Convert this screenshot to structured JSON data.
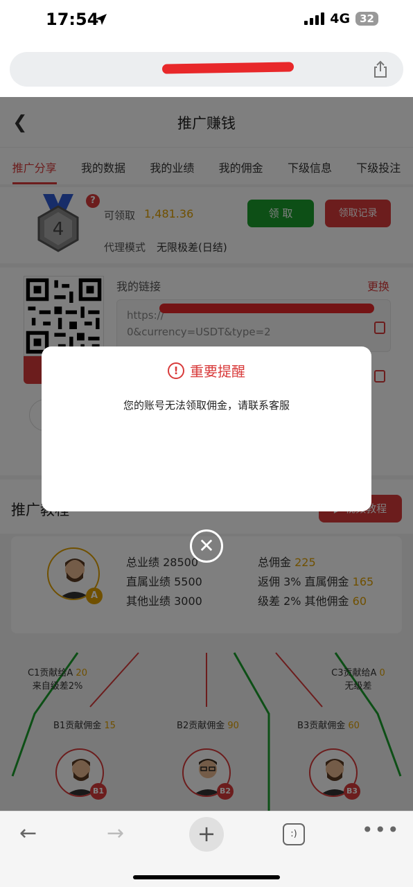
{
  "status_bar": {
    "time": "17:54",
    "network": "4G",
    "battery": "32"
  },
  "browser": {
    "toolbar_tabs_icon_text": ":)"
  },
  "header": {
    "back_icon": "chevron-left-icon",
    "title": "推广赚钱"
  },
  "tabs": [
    {
      "label": "推广分享",
      "active": true
    },
    {
      "label": "我的数据",
      "active": false
    },
    {
      "label": "我的业绩",
      "active": false
    },
    {
      "label": "我的佣金",
      "active": false
    },
    {
      "label": "下级信息",
      "active": false
    },
    {
      "label": "下级投注",
      "active": false
    }
  ],
  "reward": {
    "level": "4",
    "help_badge": "?",
    "claim_label": "可领取",
    "claim_amount": "1,481.36",
    "claim_button": "领 取",
    "record_button": "领取记录",
    "agent_mode_label": "代理模式",
    "agent_mode_value": "无限极差(日结)"
  },
  "link": {
    "label": "我的链接",
    "change_label": "更换",
    "url_line1": "https://",
    "url_line2": "0&currency=USDT&type=2"
  },
  "tutorial": {
    "title": "推广教程",
    "video_button": "视频教程",
    "stats": {
      "total_perf_label": "总业绩",
      "total_perf": "28500",
      "direct_perf_label": "直属业绩",
      "direct_perf": "5500",
      "other_perf_label": "其他业绩",
      "other_perf": "3000",
      "total_comm_label": "总佣金",
      "total_comm": "225",
      "rebate_label": "返佣 3% 直属佣金",
      "rebate_value": "165",
      "diff_label": "级差 2% 其他佣金",
      "diff_value": "60"
    },
    "avatar_badge": "A",
    "c1_label": "C1贡献给A",
    "c1_value": "20",
    "c1_sub": "来自级差2%",
    "c3_label": "C3贡献给A",
    "c3_value": "0",
    "c3_sub": "无级差",
    "b1_label": "B1贡献佣金",
    "b1_value": "15",
    "b2_label": "B2贡献佣金",
    "b2_value": "90",
    "b3_label": "B3贡献佣金",
    "b3_value": "60",
    "b1_badge": "B1",
    "b2_badge": "B2",
    "b3_badge": "B3"
  },
  "modal": {
    "icon": "exclamation-circle-icon",
    "title": "重要提醒",
    "message": "您的账号无法领取佣金，请联系客服",
    "close_icon": "close-circle-icon"
  },
  "colors": {
    "accent_red": "#d83a3a",
    "claim_green": "#1a9e2c",
    "amount_gold": "#e0a000"
  }
}
